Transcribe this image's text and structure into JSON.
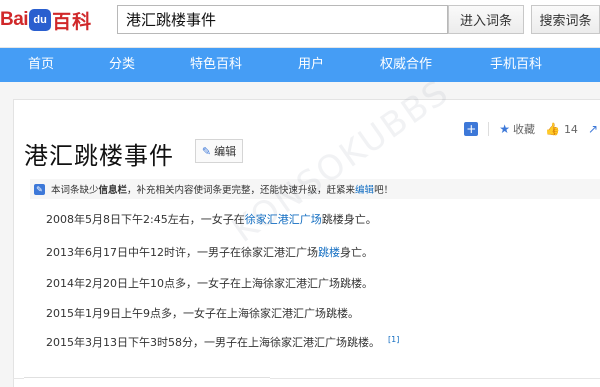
{
  "header": {
    "logo_bai": "Bai",
    "logo_paw": "du",
    "logo_baike": "百科",
    "search_value": "港汇跳楼事件",
    "enter_button": "进入词条",
    "search_button": "搜索词条"
  },
  "nav": {
    "items": [
      "首页",
      "分类",
      "特色百科",
      "用户",
      "权威合作",
      "手机百科"
    ]
  },
  "article": {
    "title": "港汇跳楼事件",
    "edit_label": "编辑",
    "tools": {
      "favorite": "收藏",
      "likes": "14"
    },
    "notice": {
      "part1": "本词条缺少",
      "bold": "信息栏",
      "part2": "，补充相关内容使词条更完整，还能快速升级，赶紧来",
      "link": "编辑",
      "part3": "吧！"
    },
    "paragraphs": [
      {
        "pre": "2008年5月8日下午2:45左右，一女子在",
        "link": "徐家汇港汇广场",
        "post": "跳楼身亡。"
      },
      {
        "pre": "2013年6月17日中午12时许，一男子在徐家汇港汇广场",
        "link": "跳楼",
        "post": "身亡。"
      },
      {
        "pre": "2014年2月20日上午10点多，一女子在上海徐家汇港汇广场跳楼。",
        "link": "",
        "post": ""
      },
      {
        "pre": "2015年1月9日上午9点多，一女子在上海徐家汇港汇广场跳楼。",
        "link": "",
        "post": ""
      },
      {
        "pre": "2015年3月13日下午3时58分，一男子在上海徐家汇港汇广场跳楼。",
        "link": "",
        "post": "",
        "ref": "[1]"
      }
    ]
  },
  "watermark": "KONSOKUBBS",
  "colors": {
    "nav_bg": "#459df5",
    "logo_red": "#d0282a",
    "link_blue": "#136ec2"
  }
}
